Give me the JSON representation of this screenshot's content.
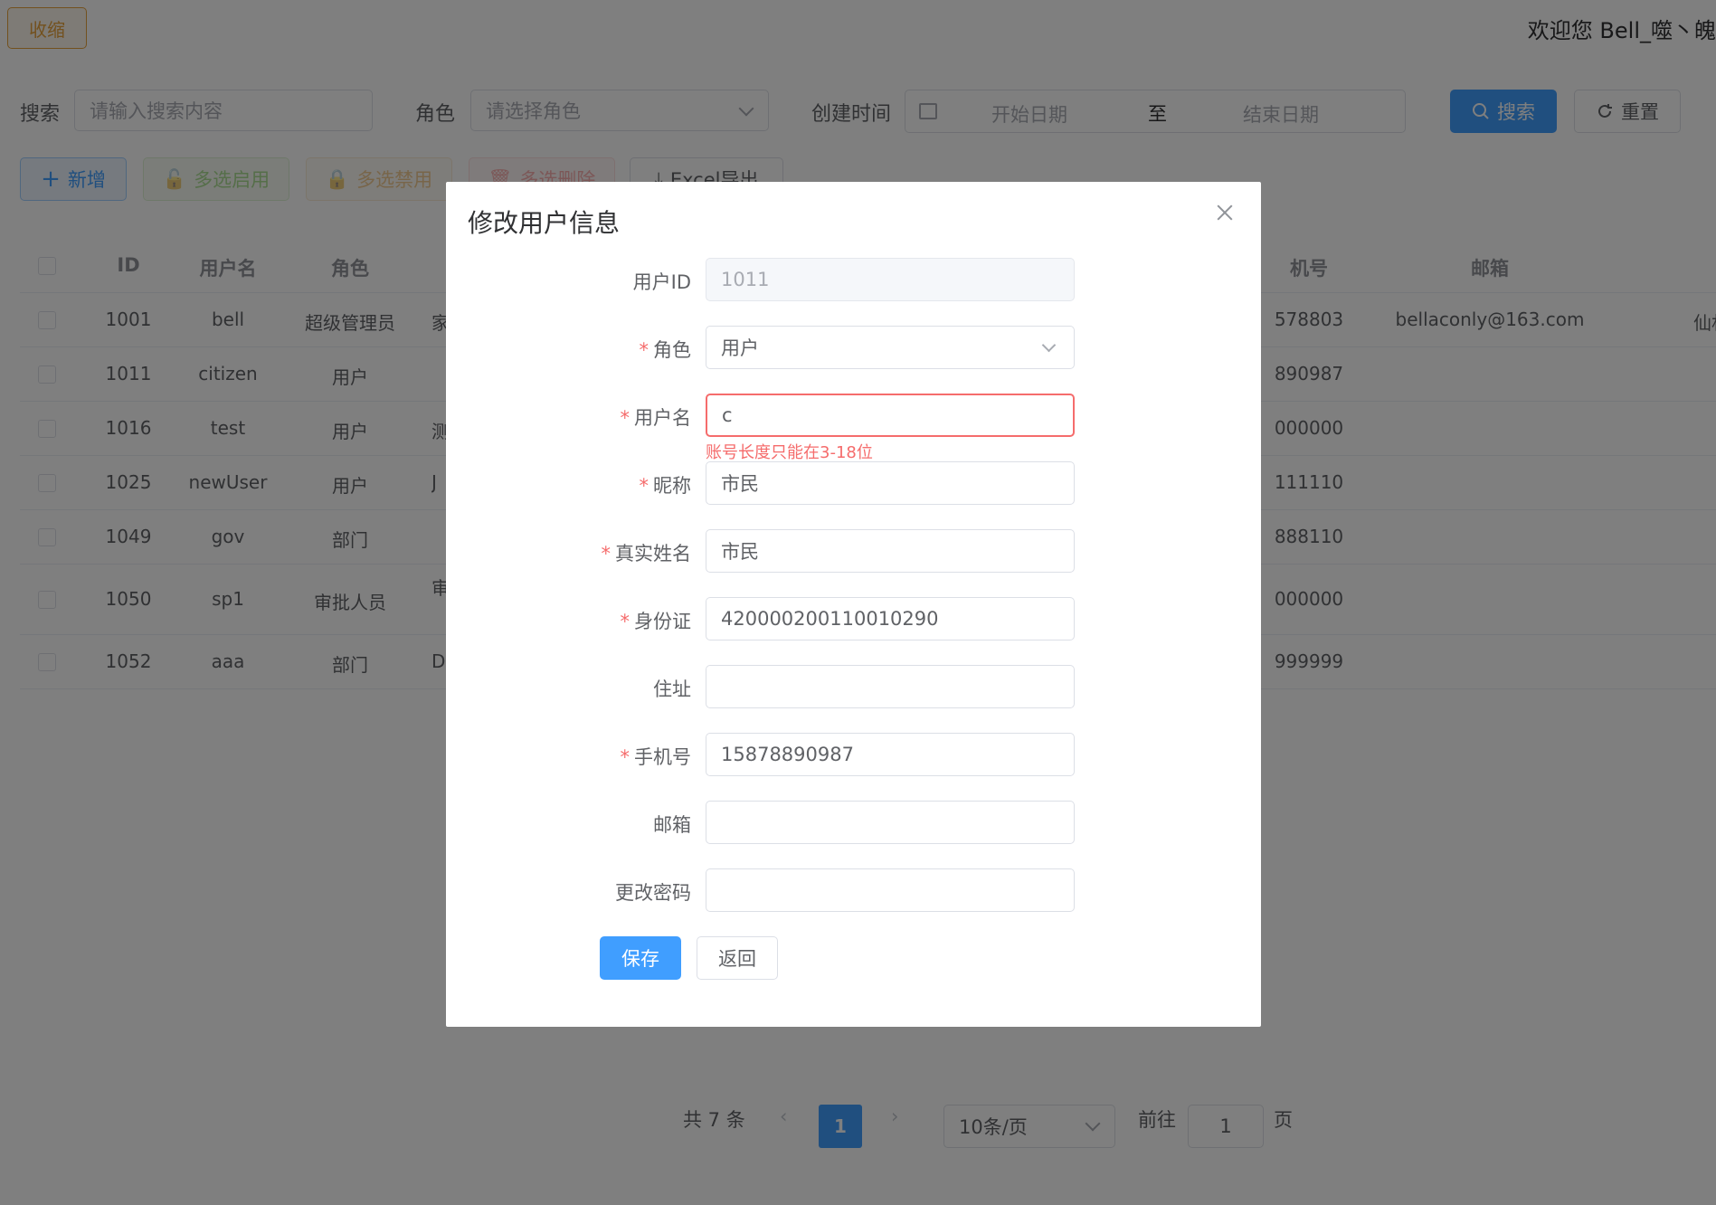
{
  "header": {
    "collapse_label": "收缩",
    "welcome_text": "欢迎您 Bell_噬丶魄"
  },
  "filters": {
    "search_label": "搜索",
    "search_placeholder": "请输入搜索内容",
    "role_label": "角色",
    "role_placeholder": "请选择角色",
    "created_label": "创建时间",
    "start_placeholder": "开始日期",
    "range_sep": "至",
    "end_placeholder": "结束日期",
    "search_button": "搜索",
    "reset_button": "重置"
  },
  "toolbar": {
    "add": "新增",
    "enable": "多选启用",
    "disable": "多选禁用",
    "delete": "多选删除",
    "export": "Excel导出"
  },
  "table": {
    "columns": {
      "id": "ID",
      "username": "用户名",
      "role": "角色",
      "phone_partial": "机号",
      "email": "邮箱"
    },
    "rows": [
      {
        "id": "1001",
        "username": "bell",
        "role": "超级管理员",
        "nick_partial": "家",
        "phone_partial": "578803",
        "email": "bellaconly@163.com",
        "extra_partial": "仙林"
      },
      {
        "id": "1011",
        "username": "citizen",
        "role": "用户",
        "nick_partial": "",
        "phone_partial": "890987",
        "email": "",
        "extra_partial": ""
      },
      {
        "id": "1016",
        "username": "test",
        "role": "用户",
        "nick_partial": "测",
        "phone_partial": "000000",
        "email": "",
        "extra_partial": ""
      },
      {
        "id": "1025",
        "username": "newUser",
        "role": "用户",
        "nick_partial": "J",
        "phone_partial": "111110",
        "email": "",
        "extra_partial": ""
      },
      {
        "id": "1049",
        "username": "gov",
        "role": "部门",
        "nick_partial": "",
        "phone_partial": "888110",
        "email": "",
        "extra_partial": ""
      },
      {
        "id": "1050",
        "username": "sp1",
        "role": "审批人员",
        "nick_partial": "审",
        "phone_partial": "000000",
        "email": "",
        "extra_partial": ""
      },
      {
        "id": "1052",
        "username": "aaa",
        "role": "部门",
        "nick_partial": "D",
        "phone_partial": "999999",
        "email": "",
        "extra_partial": ""
      }
    ]
  },
  "pagination": {
    "total": "共 7 条",
    "current": "1",
    "page_size": "10条/页",
    "goto_label": "前往",
    "goto_value": "1",
    "page_suffix": "页"
  },
  "dialog": {
    "title": "修改用户信息",
    "fields": {
      "user_id": {
        "label": "用户ID",
        "value": "1011"
      },
      "role": {
        "label": "角色",
        "value": "用户"
      },
      "username": {
        "label": "用户名",
        "value": "c",
        "error": "账号长度只能在3-18位"
      },
      "nickname": {
        "label": "昵称",
        "value": "市民"
      },
      "realname": {
        "label": "真实姓名",
        "value": "市民"
      },
      "idcard": {
        "label": "身份证",
        "value": "420000200110010290"
      },
      "address": {
        "label": "住址",
        "value": ""
      },
      "phone": {
        "label": "手机号",
        "value": "15878890987"
      },
      "email": {
        "label": "邮箱",
        "value": ""
      },
      "password": {
        "label": "更改密码",
        "value": ""
      }
    },
    "required_mark": "*",
    "save_button": "保存",
    "back_button": "返回"
  },
  "colors": {
    "primary": "#409eff",
    "danger": "#f56c6c",
    "warning": "#e6a23c",
    "success": "#67c23a"
  }
}
